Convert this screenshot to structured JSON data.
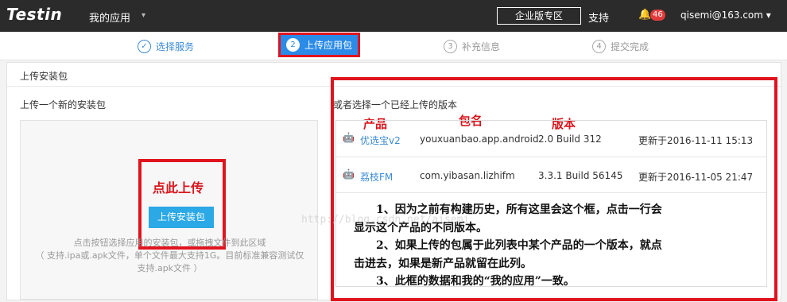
{
  "topbar": {
    "logo": "Testin",
    "my_apps": "我的应用",
    "caret": "▾",
    "enterprise": "企业版专区",
    "support": "支持",
    "bell": "🔔",
    "notif_count": "46",
    "user": "qisemi@163.com ▾"
  },
  "steps": [
    {
      "icon": "✓",
      "label": "选择服务"
    },
    {
      "icon": "2",
      "label": "上传应用包"
    },
    {
      "icon": "3",
      "label": "补充信息"
    },
    {
      "icon": "4",
      "label": "提交完成"
    }
  ],
  "card": {
    "section_title": "上传安装包",
    "left_title": "上传一个新的安装包",
    "annotation_left": "点此上传",
    "upload_button": "上传安装包",
    "hint_line1": "点击按钮选择应用的安装包，或拖拽文件到此区域",
    "hint_line2": "（ 支持.ipa或.apk文件，单个文件最大支持1G。目前标准兼容测试仅",
    "hint_line3": "支持.apk文件 ）",
    "right_title": "或者选择一个已经上传的版本",
    "header_labels": {
      "product": "产品",
      "package": "包名",
      "version": "版本"
    },
    "rows": [
      {
        "name": "优选宝v2",
        "package": "youxuanbao.app.android",
        "version": "2.0 Build 312",
        "updated": "更新于2016-11-11 15:13"
      },
      {
        "name": "荔枝FM",
        "package": "com.yibasan.lizhifm",
        "version": "3.3.1 Build 56145",
        "updated": "更新于2016-11-05 21:47"
      }
    ],
    "notes": [
      "1、因为之前有构建历史，所有这里会这个框，点击一行会",
      "显示这个产品的不同版本。",
      "2、如果上传的包属于此列表中某个产品的一个版本，就点",
      "击进去，如果是新产品就留在此列。",
      "3、此框的数据和我的“我的应用”一致。"
    ],
    "watermark": "http://blog.csdn.net/aisemi"
  },
  "colors": {
    "accent": "#2b8be8",
    "annotation": "#e0141e",
    "topbar": "#2b2b2b",
    "link": "#3b8bd6"
  }
}
